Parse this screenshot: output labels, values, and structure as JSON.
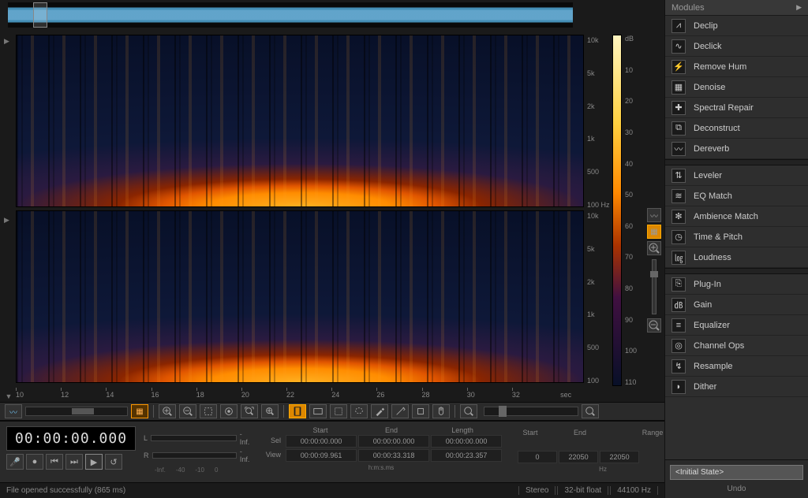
{
  "overview": {},
  "freq_labels": [
    "10k",
    "5k",
    "2k",
    "1k",
    "500",
    "100"
  ],
  "freq_unit": "Hz",
  "timeline": {
    "ticks": [
      "10",
      "12",
      "14",
      "16",
      "18",
      "20",
      "22",
      "24",
      "26",
      "28",
      "30",
      "32"
    ],
    "unit": "sec"
  },
  "db": {
    "unit": "dB",
    "labels": [
      "10",
      "20",
      "30",
      "40",
      "50",
      "60",
      "70",
      "80",
      "90",
      "100",
      "110"
    ]
  },
  "transport": {
    "timecode": "00:00:00.000",
    "meters": {
      "left_label": "L",
      "right_label": "R",
      "left_value": "-Inf.",
      "right_value": "-Inf.",
      "scale": [
        "-Inf.",
        "-40",
        "-10",
        "0"
      ]
    }
  },
  "time_table": {
    "headers": [
      "",
      "Start",
      "End",
      "Length"
    ],
    "rows": [
      {
        "label": "Sel",
        "start": "00:00:00.000",
        "end": "00:00:00.000",
        "length": "00:00:00.000"
      },
      {
        "label": "View",
        "start": "00:00:09.961",
        "end": "00:00:33.318",
        "length": "00:00:23.357"
      }
    ],
    "footer": "h:m:s.ms"
  },
  "freq_table": {
    "headers": [
      "Start",
      "End",
      "Range"
    ],
    "row": {
      "start": "0",
      "end": "22050",
      "range": "22050"
    },
    "footer": "Hz"
  },
  "status": {
    "message": "File opened successfully (865 ms)",
    "channels": "Stereo",
    "format": "32-bit float",
    "rate": "44100 Hz"
  },
  "modules": {
    "header": "Modules",
    "groups": [
      [
        "Declip",
        "Declick",
        "Remove Hum",
        "Denoise",
        "Spectral Repair",
        "Deconstruct",
        "Dereverb"
      ],
      [
        "Leveler",
        "EQ Match",
        "Ambience Match",
        "Time & Pitch",
        "Loudness"
      ],
      [
        "Plug-In",
        "Gain",
        "Equalizer",
        "Channel Ops",
        "Resample",
        "Dither"
      ]
    ]
  },
  "history": {
    "state": "<Initial State>",
    "undo_label": "Undo"
  }
}
